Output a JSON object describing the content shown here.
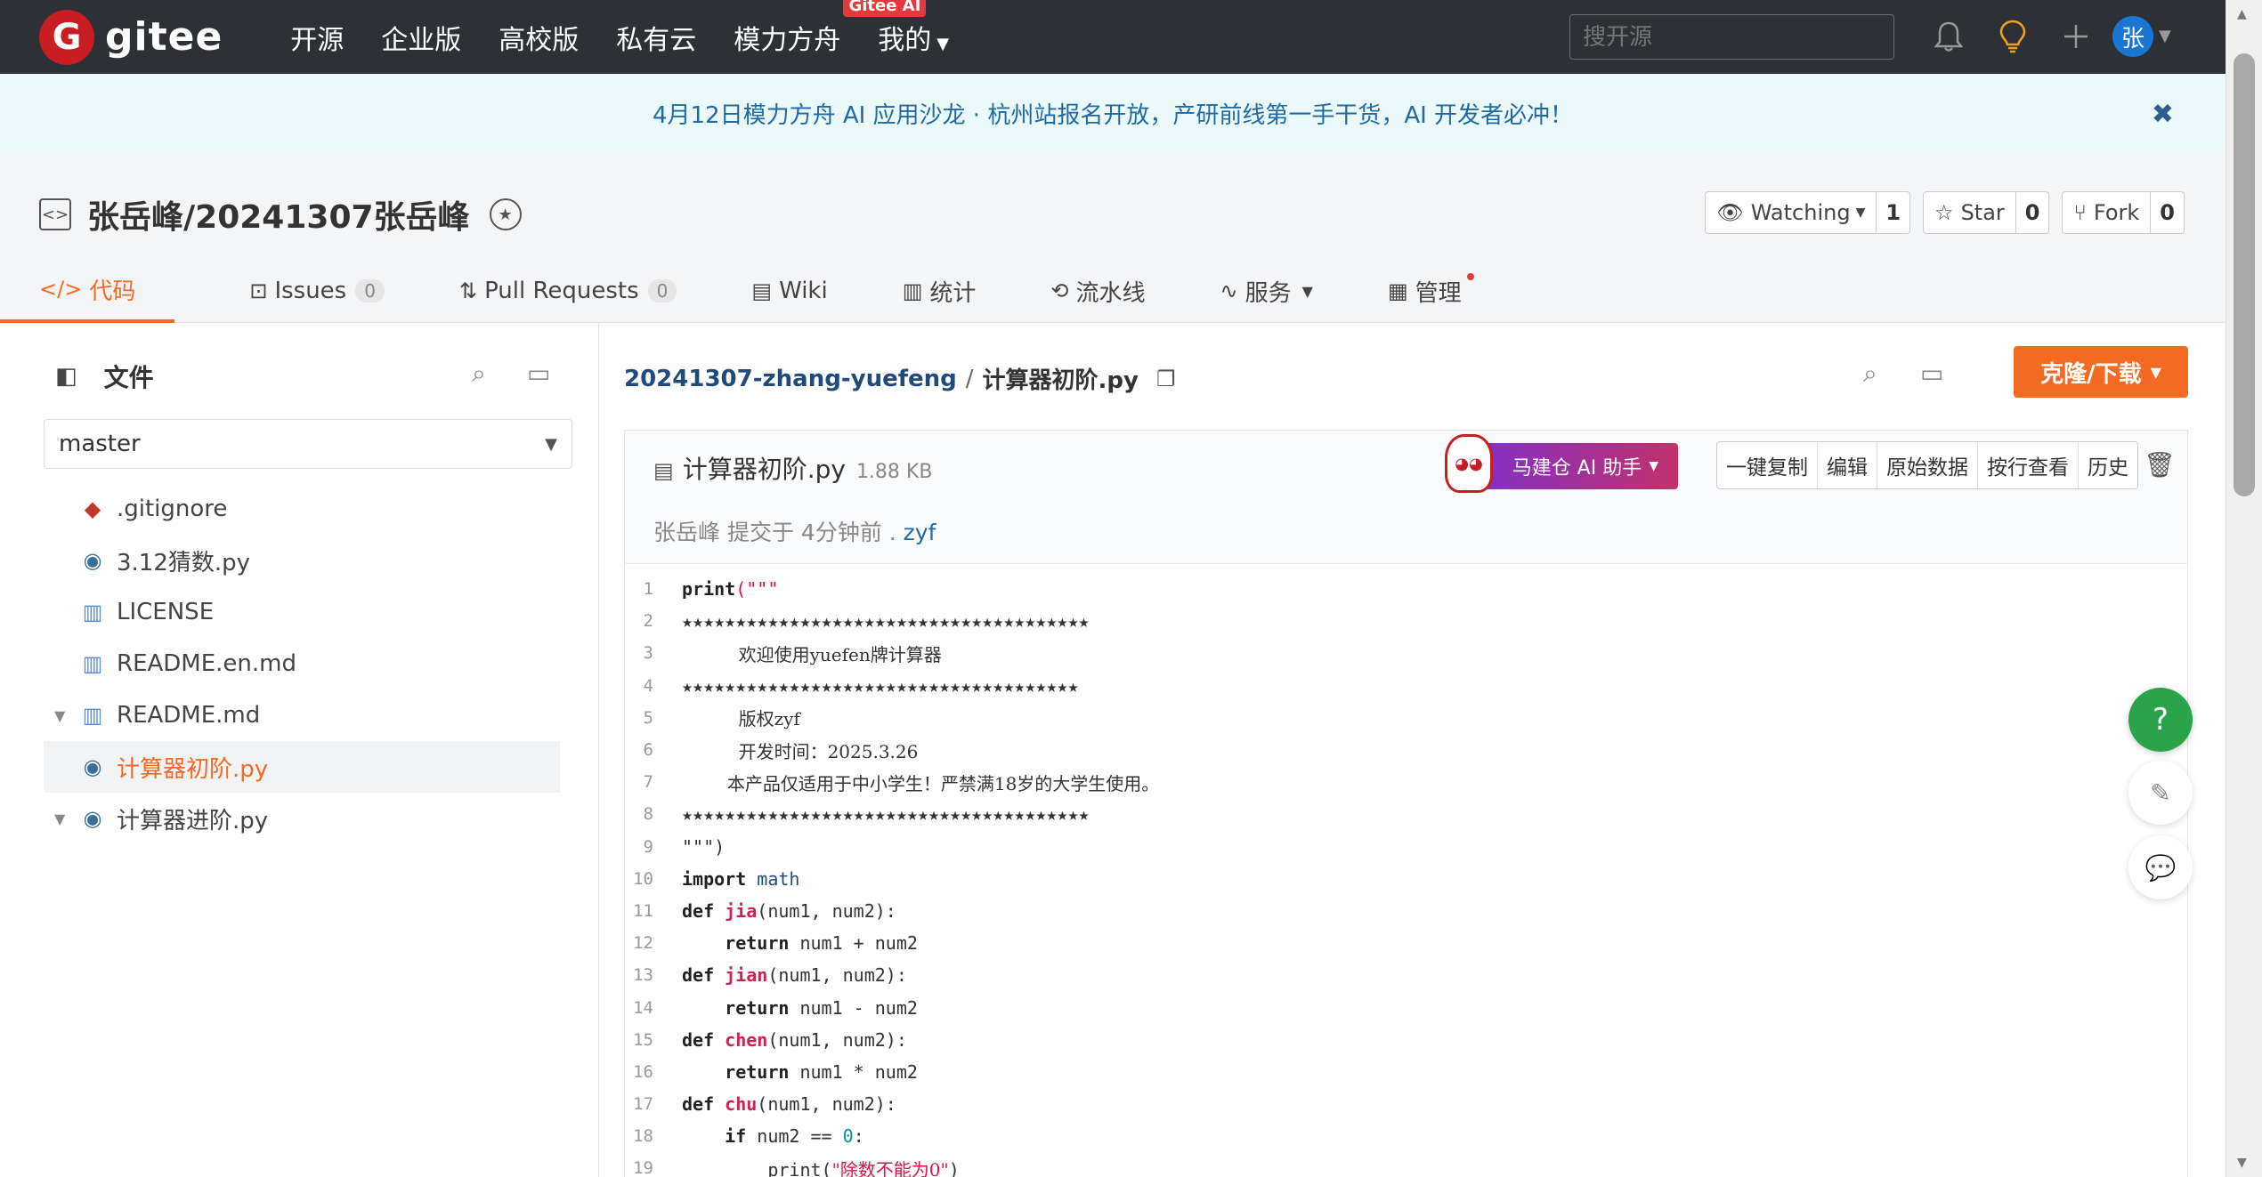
{
  "nav": {
    "logo_letter": "G",
    "logo_text": "gitee",
    "links": [
      "开源",
      "企业版",
      "高校版",
      "私有云",
      "模力方舟",
      "我的"
    ],
    "ai_badge": "Gitee AI",
    "search_placeholder": "搜开源",
    "avatar_initial": "张"
  },
  "banner": {
    "text": "4月12日模力方舟 AI 应用沙龙 · 杭州站报名开放，产研前线第一手干货，AI 开发者必冲！"
  },
  "repo": {
    "title": "张岳峰/20241307张岳峰",
    "watching_label": "Watching",
    "watching_count": "1",
    "star_label": "Star",
    "star_count": "0",
    "fork_label": "Fork",
    "fork_count": "0",
    "tabs": [
      {
        "label": "代码"
      },
      {
        "label": "Issues",
        "count": "0"
      },
      {
        "label": "Pull Requests",
        "count": "0"
      },
      {
        "label": "Wiki"
      },
      {
        "label": "统计"
      },
      {
        "label": "流水线"
      },
      {
        "label": "服务"
      },
      {
        "label": "管理"
      }
    ]
  },
  "sidebar": {
    "title": "文件",
    "branch": "master",
    "files": [
      ".gitignore",
      "3.12猜数.py",
      "LICENSE",
      "README.en.md",
      "README.md",
      "计算器初阶.py",
      "计算器进阶.py"
    ]
  },
  "file": {
    "repo_crumb": "20241307-zhang-yuefeng",
    "separator": "/",
    "name": "计算器初阶.py",
    "size": "1.88 KB",
    "clone_label": "克隆/下载",
    "ai_label": "马建仓 AI 助手",
    "actions": [
      "一键复制",
      "编辑",
      "原始数据",
      "按行查看",
      "历史"
    ],
    "commit_author": "张岳峰",
    "commit_text": " 提交于 4分钟前 . ",
    "commit_user": "zyf"
  },
  "code": {
    "line_numbers": [
      "1",
      "2",
      "3",
      "4",
      "5",
      "6",
      "7",
      "8",
      "9",
      "10",
      "11",
      "12",
      "13",
      "14",
      "15",
      "16",
      "17",
      "18",
      "19"
    ],
    "l1_fn": "print",
    "l1_rest": "(\"\"\"",
    "l2": "★★★★★★★★★★★★★★★★★★★★★★★★★★★★★★★★★★★★★★",
    "l3": "          欢迎使用yuefen牌计算器",
    "l4": "★★★★★★★★★★★★★★★★★★★★★★★★★★★★★★★★★★★★★",
    "l5": "          版权zyf",
    "l6": "          开发时间：2025.3.26",
    "l7": "        本产品仅适用于中小学生！严禁满18岁的大学生使用。",
    "l8": "★★★★★★★★★★★★★★★★★★★★★★★★★★★★★★★★★★★★★★",
    "l9": "\"\"\")",
    "import_kw": "import",
    "import_mod": " math",
    "def_kw": "def",
    "return_kw": "return",
    "if_kw": "if",
    "fn_jia": "jia",
    "fn_jian": "jian",
    "fn_chen": "chen",
    "fn_chu": "chu",
    "args": "(num1, num2):",
    "ret_add": " num1 + num2",
    "ret_sub": " num1 - num2",
    "ret_mul": " num1 * num2",
    "if_cond": " num2 == ",
    "zero": "0",
    "colon": ":",
    "l19_fn": "print",
    "l19_open": "(",
    "l19_str": "\"除数不能为0\"",
    "l19_close": ")"
  }
}
